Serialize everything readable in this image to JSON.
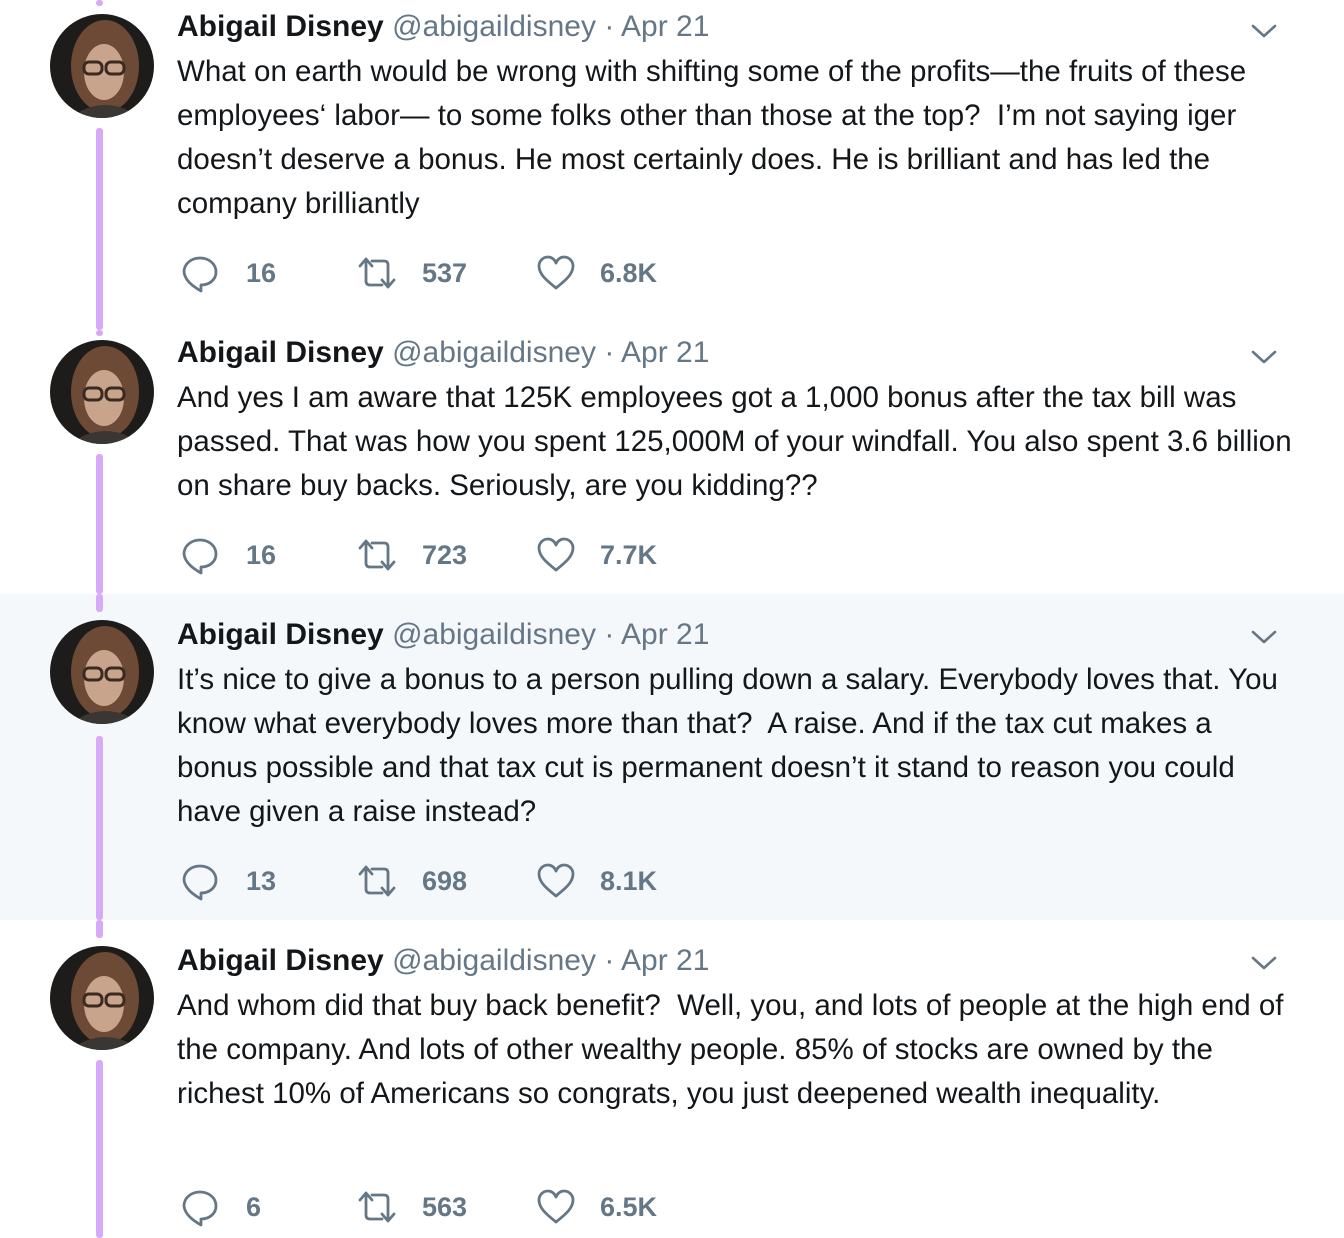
{
  "tweets": [
    {
      "name": "Abigail Disney",
      "handle": "@abigaildisney",
      "separator": "·",
      "date": "Apr 21",
      "text": "What on earth would be wrong with shifting some of the profits—the fruits of these employees‘ labor— to some folks other than those at the top?  I’m not saying iger doesn’t deserve a bonus. He most certainly does. He is brilliant and has led the company brilliantly",
      "replies": "16",
      "retweets": "537",
      "likes": "6.8K",
      "highlighted": false
    },
    {
      "name": "Abigail Disney",
      "handle": "@abigaildisney",
      "separator": "·",
      "date": "Apr 21",
      "text": "And yes I am aware that 125K employees got a 1,000 bonus after the tax bill was passed. That was how you spent 125,000M of your windfall. You also spent 3.6 billion on share buy backs. Seriously, are you kidding??",
      "replies": "16",
      "retweets": "723",
      "likes": "7.7K",
      "highlighted": false
    },
    {
      "name": "Abigail Disney",
      "handle": "@abigaildisney",
      "separator": "·",
      "date": "Apr 21",
      "text": "It’s nice to give a bonus to a person pulling down a salary. Everybody loves that. You know what everybody loves more than that?  A raise. And if the tax cut makes a bonus possible and that tax cut is permanent doesn’t it stand to reason you could have given a raise instead?",
      "replies": "13",
      "retweets": "698",
      "likes": "8.1K",
      "highlighted": true
    },
    {
      "name": "Abigail Disney",
      "handle": "@abigaildisney",
      "separator": "·",
      "date": "Apr 21",
      "text": "And whom did that buy back benefit?  Well, you, and lots of people at the high end of the company. And lots of other wealthy people. 85% of stocks are owned by the richest 10% of Americans so congrats, you just deepened wealth inequality.",
      "replies": "6",
      "retweets": "563",
      "likes": "6.5K",
      "highlighted": false
    }
  ],
  "colors": {
    "thread_line": "#d7aaf8",
    "highlight_bg": "#f5f8fa",
    "secondary_text": "#657786",
    "primary_text": "#14171a"
  },
  "icons": {
    "reply": "reply-icon",
    "retweet": "retweet-icon",
    "like": "heart-icon",
    "menu": "chevron-down-icon"
  }
}
